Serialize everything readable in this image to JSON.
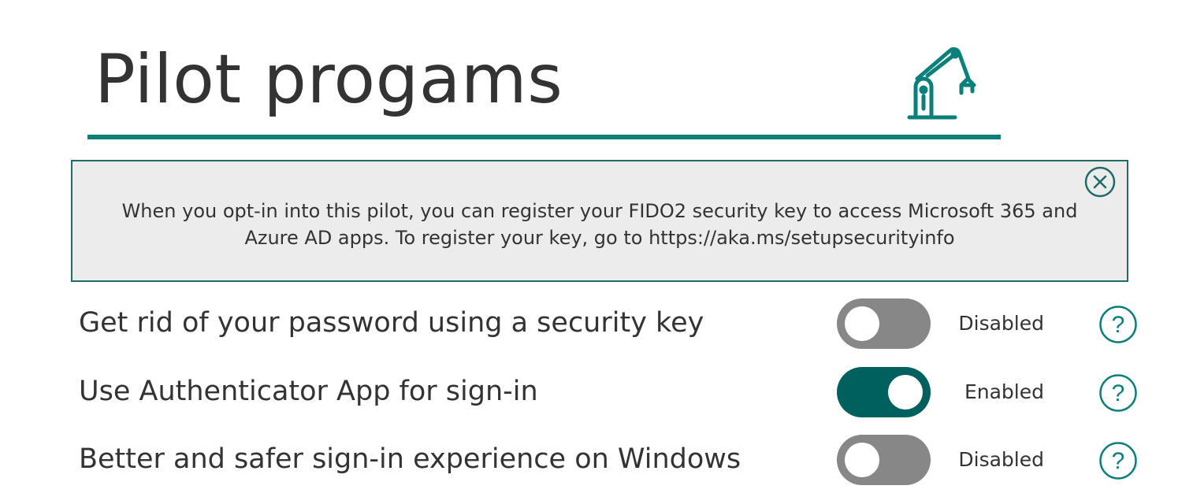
{
  "header": {
    "title": "Pilot progams",
    "icon": "robot-arm-icon",
    "accent_color": "#0b7f7a"
  },
  "banner": {
    "text_line1": "When you opt-in into this pilot, you can register your FIDO2 security key to access Microsoft 365 and",
    "text_line2": "Azure AD apps. To register your key, go to https://aka.ms/setupsecurityinfo",
    "close_icon": "close-circle-icon",
    "background": "#ececec",
    "border_color": "#1e6b67"
  },
  "settings": [
    {
      "label": "Get rid of your password using a security key",
      "enabled": false,
      "status": "Disabled",
      "help_icon": "help-circle-icon"
    },
    {
      "label": "Use Authenticator App for sign-in",
      "enabled": true,
      "status": "Enabled",
      "help_icon": "help-circle-icon"
    },
    {
      "label": "Better and safer sign-in experience on Windows",
      "enabled": false,
      "status": "Disabled",
      "help_icon": "help-circle-icon"
    }
  ],
  "colors": {
    "toggle_on": "#00605e",
    "toggle_off": "#878787",
    "help_icon": "#0b7f7a"
  }
}
